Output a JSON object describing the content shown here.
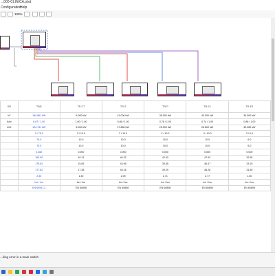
{
  "window": {
    "title": "...000-CLINICA.plsd"
  },
  "menu": {
    "items": [
      "Configuration",
      "Help"
    ]
  },
  "toolbar": {
    "zoom": "100%"
  },
  "table": {
    "headers": [
      "SR",
      "TBD",
      "TR CT",
      "TR S",
      "TR P",
      "TR E1",
      "TR E2"
    ],
    "rows": [
      [
        "kV",
        "184.861 kW",
        "6.000 kW",
        "41.000 kW",
        "36.000 kW",
        "40.000 kW",
        "34.000 kW"
      ],
      [
        "kVar",
        "6.87 / 1.00",
        "1.00 / 1.00",
        "0.86 / 1.00",
        "0.76 / 1.00",
        "0.74 / 1.00",
        "0.86 / 1.00"
      ],
      [
        "kVA",
        "124.741 kW",
        "5.000 kW",
        "27.880 kW",
        "25.200 kW",
        "26.800 kW",
        "30.060 kW"
      ],
      [
        "",
        "3 / 75.0",
        "3 / 10.0",
        "3 / 10.0",
        "3 / 10.0",
        "3 / 10.0",
        "3 / 6.0"
      ],
      [
        "",
        "75.0",
        "10.0",
        "10.0",
        "10.0",
        "10.0",
        "6.0"
      ],
      [
        "",
        "75.0",
        "10.0",
        "10.0",
        "10.0",
        "10.0",
        "6.0"
      ],
      [
        "",
        "4.482",
        "0.000",
        "0.000",
        "0.000",
        "0.000",
        "0.000"
      ],
      [
        "",
        "163.50",
        "16.13",
        "46.32",
        "42.62",
        "47.63",
        "32.95"
      ],
      [
        "",
        "178.82",
        "15.83",
        "43.96",
        "39.85",
        "46.47",
        "33.19"
      ],
      [
        "",
        "177.82",
        "17.38",
        "45.16",
        "39.29",
        "46.28",
        "31.50"
      ],
      [
        "",
        "2.35",
        "1.30",
        "2.09",
        "2.71",
        "2.77",
        "1.50"
      ],
      [
        "",
        "Icn / Icu",
        "Icn / Icu",
        "Icn / Icu",
        "Icn / Icu",
        "Icn / Icu",
        "Icn / Icu"
      ],
      [
        "",
        "EN 60947-2",
        "EN 60898",
        "EN 60898",
        "EN 60898",
        "EN 60898",
        "EN 60898"
      ]
    ]
  },
  "status": {
    "message": "...king error in a main switch"
  },
  "colors": {
    "wire_red": "#e02020",
    "wire_green": "#2db24a",
    "wire_blue": "#3a6fe0",
    "wire_purple": "#8a3fb5",
    "accent": "#2c4fd8"
  }
}
